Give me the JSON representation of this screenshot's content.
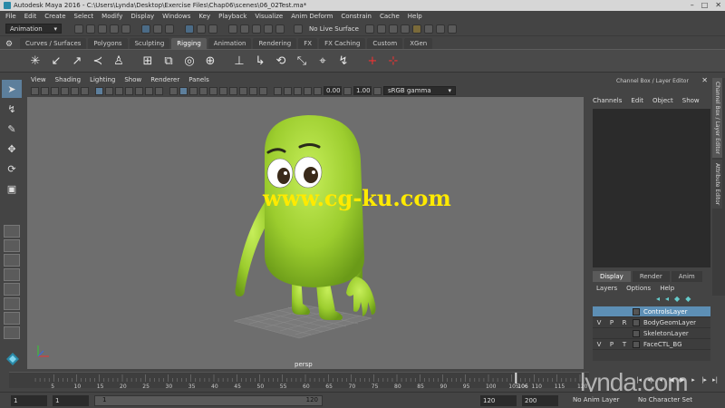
{
  "title_bar": {
    "text": "Autodesk Maya 2016 - C:\\Users\\Lynda\\Desktop\\Exercise Files\\Chap06\\scenes\\06_02Test.ma*"
  },
  "menu_bar": [
    "File",
    "Edit",
    "Create",
    "Select",
    "Modify",
    "Display",
    "Windows",
    "Key",
    "Playback",
    "Visualize",
    "Anim Deform",
    "Constrain",
    "Cache",
    "Help"
  ],
  "status_line": {
    "menu_set": "Animation",
    "live_surface": "No Live Surface"
  },
  "shelf_tabs": [
    {
      "label": "Curves / Surfaces"
    },
    {
      "label": "Polygons"
    },
    {
      "label": "Sculpting"
    },
    {
      "label": "Rigging",
      "active": true
    },
    {
      "label": "Animation"
    },
    {
      "label": "Rendering"
    },
    {
      "label": "FX"
    },
    {
      "label": "FX Caching"
    },
    {
      "label": "Custom"
    },
    {
      "label": "XGen"
    }
  ],
  "viewport": {
    "menu": [
      "View",
      "Shading",
      "Lighting",
      "Show",
      "Renderer",
      "Panels"
    ],
    "exposure": "0.00",
    "gamma": "1.00",
    "color_space": "sRGB gamma",
    "camera_label": "persp"
  },
  "channel_box": {
    "header": "Channel Box / Layer Editor",
    "menu": [
      "Channels",
      "Edit",
      "Object",
      "Show"
    ]
  },
  "side_tabs": [
    "Channel Box / Layer Editor",
    "Attribute Editor"
  ],
  "layer_editor": {
    "tabs": [
      {
        "label": "Display",
        "active": true
      },
      {
        "label": "Render"
      },
      {
        "label": "Anim"
      }
    ],
    "menu": [
      "Layers",
      "Options",
      "Help"
    ],
    "layers": [
      {
        "v": "",
        "p": "",
        "r": "",
        "name": "ControlsLayer",
        "selected": true
      },
      {
        "v": "V",
        "p": "P",
        "r": "R",
        "name": "BodyGeomLayer"
      },
      {
        "v": "",
        "p": "",
        "r": "",
        "name": "SkeletonLayer"
      },
      {
        "v": "V",
        "p": "P",
        "r": "T",
        "name": "FaceCTL_BG"
      }
    ]
  },
  "timeline": {
    "ticks": [
      "5",
      "10",
      "15",
      "20",
      "25",
      "30",
      "35",
      "40",
      "45",
      "50",
      "55",
      "60",
      "65",
      "70",
      "75",
      "80",
      "85",
      "90",
      "95",
      "100",
      "105",
      "110",
      "115",
      "120"
    ],
    "current_frame": "106"
  },
  "range_bar": {
    "start_field": "1",
    "start_anim": "1",
    "range_start": "1",
    "range_end": "120",
    "end_field": "120",
    "end_anim": "200",
    "anim_layer": "No Anim Layer",
    "character_set": "No Character Set"
  },
  "watermark": "www.cg-ku.com",
  "brand": "lynda.com",
  "colors": {
    "character": "#9ccd2e",
    "selected_layer": "#5d8fb5",
    "accent_blue": "#5d7f9c"
  }
}
